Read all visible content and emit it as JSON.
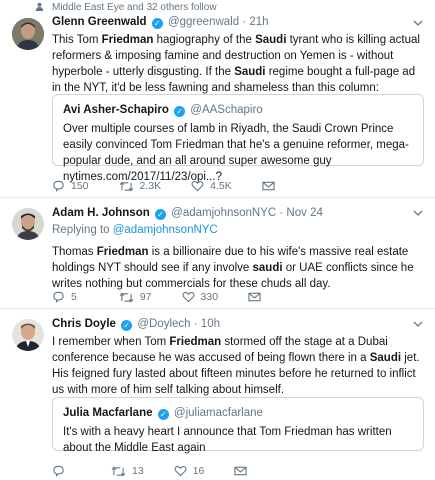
{
  "context": {
    "text": "Middle East Eye and 32 others follow"
  },
  "tweets": [
    {
      "name": "Glenn Greenwald",
      "handle": "@ggreenwald",
      "time": "21h",
      "text_parts": {
        "a": "This Tom ",
        "b": "Friedman",
        "c": " hagiography of the ",
        "d": "Saudi",
        "e": " tyrant who is killing actual reformers & imposing famine and destruction on Yemen is - without hyperbole - utterly disgusting. If the ",
        "f": "Saudi",
        "g": " regime bought a full-page ad in the NYT, it'd be less fawning and shameless than this column:"
      },
      "quote": {
        "name": "Avi Asher-Schapiro",
        "handle": "@AASchapiro",
        "text": "Over multiple courses of lamb in Riyadh, the Saudi Crown Prince easily convinced Tom Friedman that he's a genuine reformer, mega-popular dude, and an all around super awesome guy nytimes.com/2017/11/23/opi...?"
      },
      "replies": "150",
      "retweets": "2.3K",
      "likes": "4.5K"
    },
    {
      "name": "Adam H. Johnson",
      "handle": "@adamjohnsonNYC",
      "time": "Nov 24",
      "reply_prefix": "Replying to ",
      "reply_to": "@adamjohnsonNYC",
      "text_parts": {
        "a": "Thomas ",
        "b": "Friedman",
        "c": " is a billionaire due to his wife's massive real estate holdings NYT should see if any involve ",
        "d": "saudi",
        "e": " or UAE conflicts since he writes nothing but commercials for these chuds all day."
      },
      "replies": "5",
      "retweets": "97",
      "likes": "330"
    },
    {
      "name": "Chris Doyle",
      "handle": "@Doylech",
      "time": "10h",
      "text_parts": {
        "a": "I remember when Tom ",
        "b": "Friedman",
        "c": " stormed off the stage at a Dubai conference because he was accused of being flown there in a ",
        "d": "Saudi",
        "e": " jet.  His feigned fury lasted about fifteen minutes before he returned to inflict us with more of him self talking about himself."
      },
      "quote": {
        "name": "Julia Macfarlane",
        "handle": "@juliamacfarlane",
        "text": "It's with a heavy heart I announce that Tom Friedman has written about the Middle East again"
      },
      "replies": "",
      "retweets": "13",
      "likes": "16"
    }
  ],
  "separator": " · ",
  "colors": {
    "link": "#1b95e0",
    "muted": "#657786",
    "border": "#e6ecf0",
    "verified": "#1da1f2"
  }
}
